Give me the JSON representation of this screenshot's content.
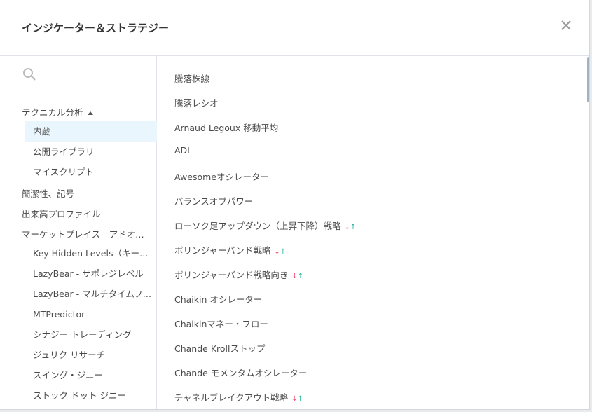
{
  "dialog": {
    "title": "インジケーター＆ストラテジー",
    "close_icon": "close-icon"
  },
  "search": {
    "placeholder": "",
    "value": ""
  },
  "sidebar": {
    "technical": "テクニカル分析",
    "technical_sub": [
      "内蔵",
      "公開ライブラリ",
      "マイスクリプト"
    ],
    "cats": [
      "簡潔性、記号",
      "出来高プロファイル",
      "マーケットプレイス　アドオ…"
    ],
    "market_sub": [
      "Key Hidden Levels（キー…",
      "LazyBear - サポレジレベル",
      "LazyBear - マルチタイムフ…",
      "MTPredictor",
      "シナジー トレーディング",
      "ジュリク リサーチ",
      "スイング・ジニー",
      "ストック ドット ジニー"
    ]
  },
  "list": [
    {
      "label": "騰落株線",
      "strategy": false
    },
    {
      "label": "騰落レシオ",
      "strategy": false
    },
    {
      "label": "Arnaud Legoux 移動平均",
      "strategy": false
    },
    {
      "label": "ADI",
      "strategy": false
    },
    {
      "label": "Awesomeオシレーター",
      "strategy": false
    },
    {
      "label": "バランスオブパワー",
      "strategy": false
    },
    {
      "label": "ローソク足アップダウン（上昇下降）戦略",
      "strategy": true
    },
    {
      "label": "ボリンジャーバンド戦略",
      "strategy": true
    },
    {
      "label": "ボリンジャーバンド戦略向き",
      "strategy": true
    },
    {
      "label": "Chaikin オシレーター",
      "strategy": false
    },
    {
      "label": "Chaikinマネー・フロー",
      "strategy": false
    },
    {
      "label": "Chande Krollストップ",
      "strategy": false
    },
    {
      "label": "Chande モメンタムオシレーター",
      "strategy": false
    },
    {
      "label": "チャネルブレイクアウト戦略",
      "strategy": true
    }
  ],
  "arrows": {
    "down": "↓",
    "up": "↑"
  },
  "colors": {
    "down": "#f04a6a",
    "up": "#26b39a",
    "active_bg": "#eaf6fd"
  }
}
